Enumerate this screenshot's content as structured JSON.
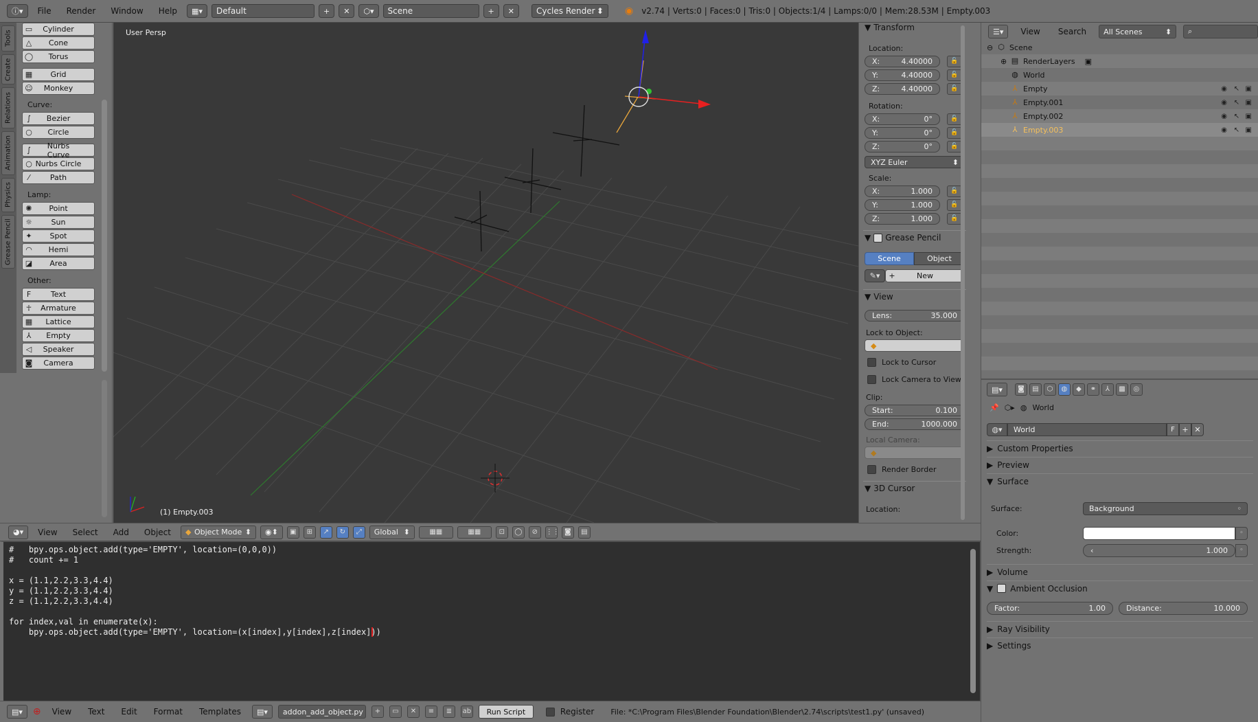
{
  "topbar": {
    "menus": [
      "File",
      "Render",
      "Window",
      "Help"
    ],
    "layout": "Default",
    "scene": "Scene",
    "engine": "Cycles Render",
    "info": "v2.74 | Verts:0 | Faces:0 | Tris:0 | Objects:1/4 | Lamps:0/0 | Mem:28.53M | Empty.003"
  },
  "tabs": [
    "Tools",
    "Create",
    "Relations",
    "Animation",
    "Physics",
    "Grease Pencil"
  ],
  "toolshelf": {
    "mesh": [
      "Cylinder",
      "Cone",
      "Torus",
      "Grid",
      "Monkey"
    ],
    "curve_label": "Curve:",
    "curve": [
      "Bezier",
      "Circle",
      "Nurbs Curve",
      "Nurbs Circle",
      "Path"
    ],
    "lamp_label": "Lamp:",
    "lamp": [
      "Point",
      "Sun",
      "Spot",
      "Hemi",
      "Area"
    ],
    "other_label": "Other:",
    "other": [
      "Text",
      "Armature",
      "Lattice",
      "Empty",
      "Speaker",
      "Camera"
    ]
  },
  "viewport": {
    "label": "User Persp",
    "object": "(1) Empty.003"
  },
  "npanel": {
    "transform": "Transform",
    "location_label": "Location:",
    "location": [
      {
        "axis": "X:",
        "value": "4.40000"
      },
      {
        "axis": "Y:",
        "value": "4.40000"
      },
      {
        "axis": "Z:",
        "value": "4.40000"
      }
    ],
    "rotation_label": "Rotation:",
    "rotation": [
      {
        "axis": "X:",
        "value": "0°"
      },
      {
        "axis": "Y:",
        "value": "0°"
      },
      {
        "axis": "Z:",
        "value": "0°"
      }
    ],
    "rotation_mode": "XYZ Euler",
    "scale_label": "Scale:",
    "scale": [
      {
        "axis": "X:",
        "value": "1.000"
      },
      {
        "axis": "Y:",
        "value": "1.000"
      },
      {
        "axis": "Z:",
        "value": "1.000"
      }
    ],
    "grease_pencil": "Grease Pencil",
    "gp_scene": "Scene",
    "gp_object": "Object",
    "gp_new": "New",
    "view": "View",
    "lens_label": "Lens:",
    "lens": "35.000",
    "lock_to_object": "Lock to Object:",
    "lock_to_cursor": "Lock to Cursor",
    "lock_camera": "Lock Camera to View",
    "clip_label": "Clip:",
    "clip_start_label": "Start:",
    "clip_start": "0.100",
    "clip_end_label": "End:",
    "clip_end": "1000.000",
    "local_camera": "Local Camera:",
    "render_border": "Render Border",
    "cursor3d": "3D Cursor",
    "cursor_location": "Location:"
  },
  "vpheader": {
    "view": "View",
    "select": "Select",
    "add": "Add",
    "object": "Object",
    "mode": "Object Mode",
    "orientation": "Global"
  },
  "code": "#   bpy.ops.object.add(type='EMPTY', location=(0,0,0))\n#   count += 1\n\nx = (1.1,2.2,3.3,4.4)\ny = (1.1,2.2,3.3,4.4)\nz = (1.1,2.2,3.3,4.4)\n\nfor index,val in enumerate(x):\n    bpy.ops.object.add(type='EMPTY', location=(x[index],y[index],z[index]))",
  "teheader": {
    "view": "View",
    "text": "Text",
    "edit": "Edit",
    "format": "Format",
    "templates": "Templates",
    "filename": "addon_add_object.py",
    "run": "Run Script",
    "register": "Register",
    "file": "File: *C:\\Program Files\\Blender Foundation\\Blender\\2.74\\scripts\\test1.py' (unsaved)"
  },
  "outliner": {
    "view": "View",
    "search": "Search",
    "filter": "All Scenes",
    "items": [
      "Scene",
      "RenderLayers",
      "World",
      "Empty",
      "Empty.001",
      "Empty.002",
      "Empty.003"
    ]
  },
  "props": {
    "context": "World",
    "world_name": "World",
    "world_f": "F",
    "custom": "Custom Properties",
    "preview": "Preview",
    "surface": "Surface",
    "surface_label": "Surface:",
    "surface_value": "Background",
    "color_label": "Color:",
    "strength_label": "Strength:",
    "strength": "1.000",
    "volume": "Volume",
    "ao": "Ambient Occlusion",
    "factor_label": "Factor:",
    "factor": "1.00",
    "distance_label": "Distance:",
    "distance": "10.000",
    "ray": "Ray Visibility",
    "settings": "Settings"
  },
  "colors": {
    "accent": "#5680c2",
    "selected": "#f5c05c",
    "viewport": "#393939",
    "panel": "#727272"
  }
}
